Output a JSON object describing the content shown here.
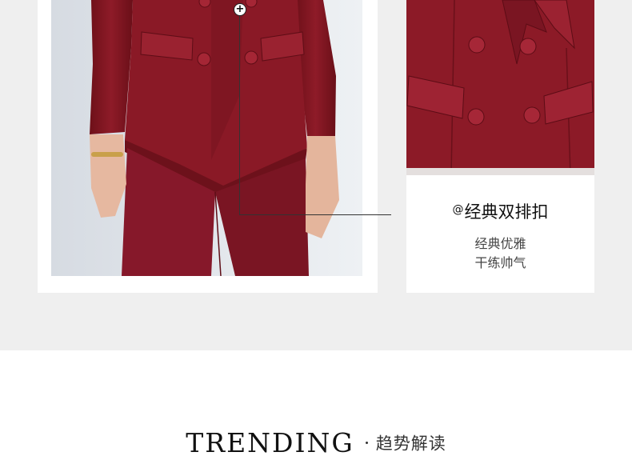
{
  "feature": {
    "at_symbol": "@",
    "title": "经典双排扣",
    "desc_lines": [
      "经典优雅",
      "干练帅气"
    ]
  },
  "callout": {
    "marker": "+"
  },
  "section_heading": {
    "english": "TRENDING",
    "chinese": "趋势解读"
  },
  "colors": {
    "band_gray": "#efefef",
    "garment_red": "#8b1a26"
  }
}
